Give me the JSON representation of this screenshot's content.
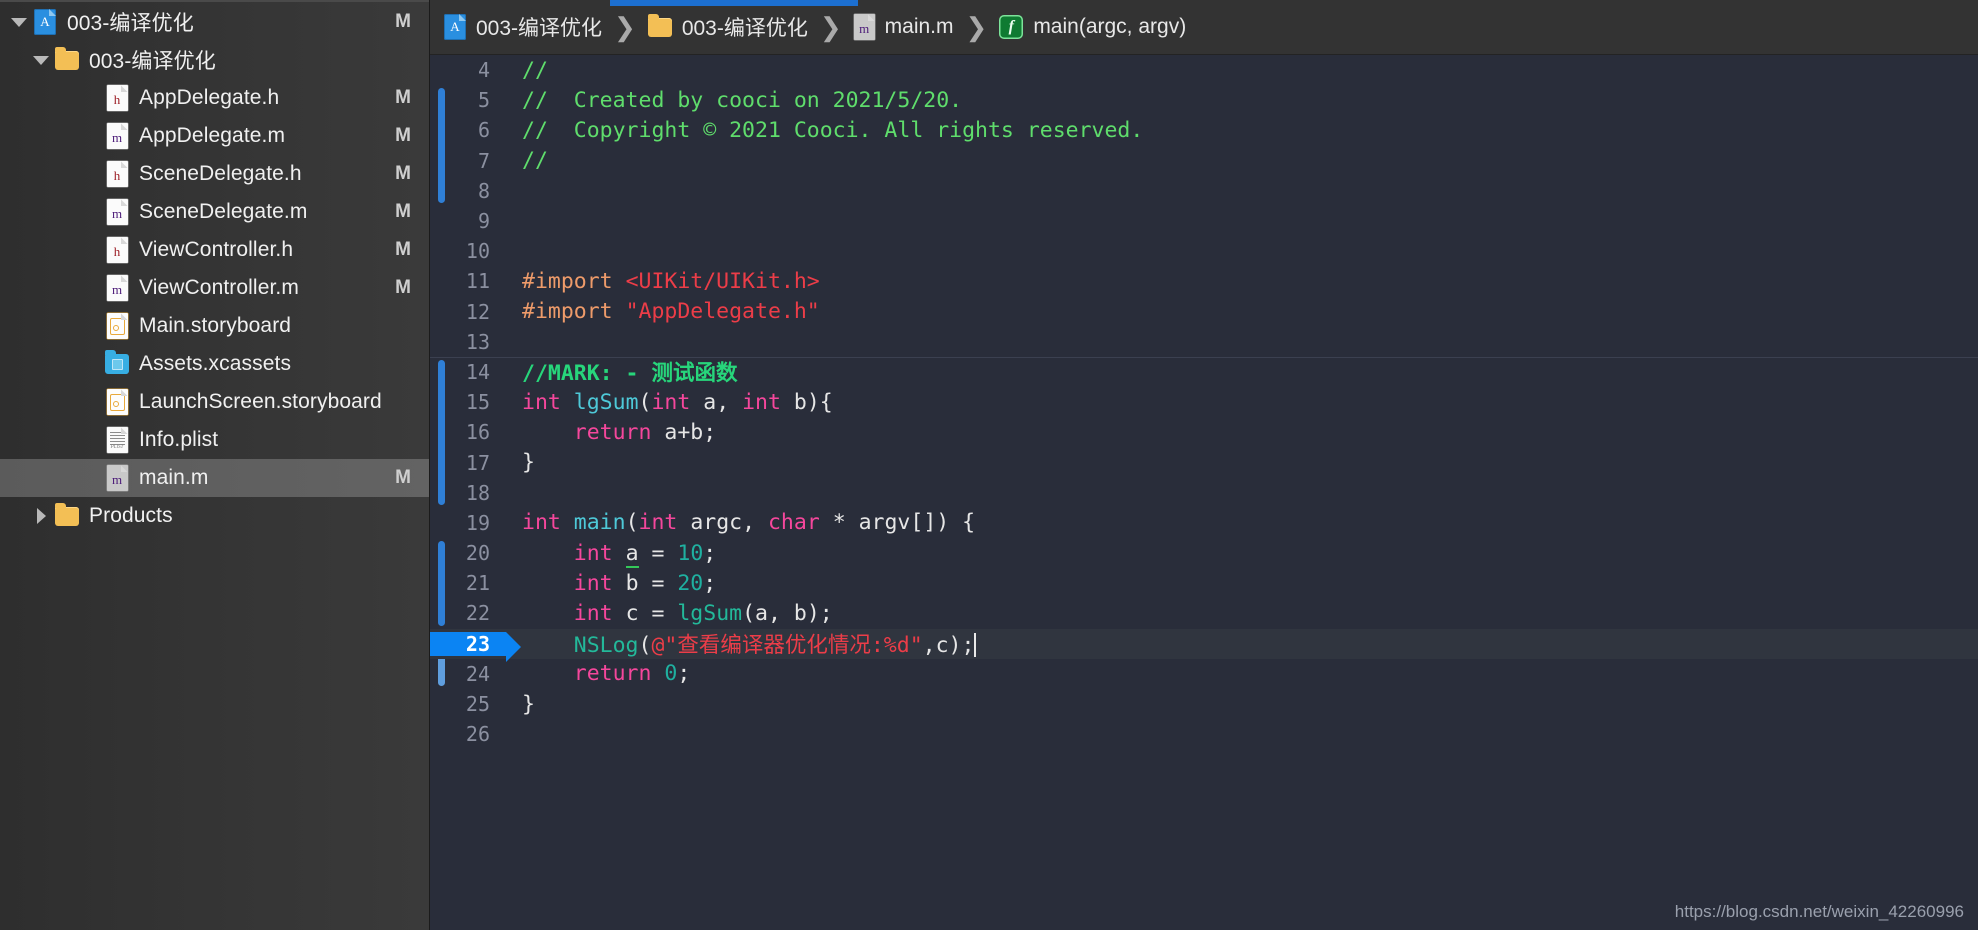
{
  "sidebar": {
    "items": [
      {
        "label": "003-编译优化",
        "icon": "xcode-project-icon",
        "badge": "M",
        "disc": "down",
        "indent": 0,
        "selected": false
      },
      {
        "label": "003-编译优化",
        "icon": "folder-icon",
        "badge": "",
        "disc": "down",
        "indent": 1,
        "selected": false
      },
      {
        "label": "AppDelegate.h",
        "icon": "header-file-icon",
        "badge": "M",
        "disc": "",
        "indent": 2,
        "selected": false
      },
      {
        "label": "AppDelegate.m",
        "icon": "objc-file-icon",
        "badge": "M",
        "disc": "",
        "indent": 2,
        "selected": false
      },
      {
        "label": "SceneDelegate.h",
        "icon": "header-file-icon",
        "badge": "M",
        "disc": "",
        "indent": 2,
        "selected": false
      },
      {
        "label": "SceneDelegate.m",
        "icon": "objc-file-icon",
        "badge": "M",
        "disc": "",
        "indent": 2,
        "selected": false
      },
      {
        "label": "ViewController.h",
        "icon": "header-file-icon",
        "badge": "M",
        "disc": "",
        "indent": 2,
        "selected": false
      },
      {
        "label": "ViewController.m",
        "icon": "objc-file-icon",
        "badge": "M",
        "disc": "",
        "indent": 2,
        "selected": false
      },
      {
        "label": "Main.storyboard",
        "icon": "storyboard-icon",
        "badge": "",
        "disc": "",
        "indent": 2,
        "selected": false
      },
      {
        "label": "Assets.xcassets",
        "icon": "xcassets-icon",
        "badge": "",
        "disc": "",
        "indent": 2,
        "selected": false
      },
      {
        "label": "LaunchScreen.storyboard",
        "icon": "storyboard-icon",
        "badge": "",
        "disc": "",
        "indent": 2,
        "selected": false
      },
      {
        "label": "Info.plist",
        "icon": "plist-file-icon",
        "badge": "",
        "disc": "",
        "indent": 2,
        "selected": false
      },
      {
        "label": "main.m",
        "icon": "objc-file-icon-grey",
        "badge": "M",
        "disc": "",
        "indent": 2,
        "selected": true
      },
      {
        "label": "Products",
        "icon": "folder-icon",
        "badge": "",
        "disc": "right",
        "indent": 1,
        "selected": false
      }
    ]
  },
  "jumpbar": {
    "crumbs": [
      {
        "label": "003-编译优化",
        "icon": "xcode-project-icon"
      },
      {
        "label": "003-编译优化",
        "icon": "folder-icon"
      },
      {
        "label": "main.m",
        "icon": "objc-file-icon-grey"
      },
      {
        "label": "main(argc, argv)",
        "icon": "function-icon"
      }
    ],
    "separator": "❯"
  },
  "editor": {
    "cursor_line": 23,
    "lines": [
      {
        "n": "4",
        "tokens": [
          {
            "t": "//",
            "c": "t-cmt"
          }
        ]
      },
      {
        "n": "5",
        "tokens": [
          {
            "t": "//  Created by cooci on 2021/5/20.",
            "c": "t-cmt"
          }
        ]
      },
      {
        "n": "6",
        "tokens": [
          {
            "t": "//  Copyright © 2021 Cooci. All rights reserved.",
            "c": "t-cmt"
          }
        ]
      },
      {
        "n": "7",
        "tokens": [
          {
            "t": "//",
            "c": "t-cmt"
          }
        ]
      },
      {
        "n": "8",
        "tokens": []
      },
      {
        "n": "9",
        "tokens": []
      },
      {
        "n": "10",
        "tokens": []
      },
      {
        "n": "11",
        "tokens": [
          {
            "t": "#import ",
            "c": "t-pre"
          },
          {
            "t": "<UIKit/UIKit.h>",
            "c": "t-str"
          }
        ]
      },
      {
        "n": "12",
        "tokens": [
          {
            "t": "#import ",
            "c": "t-pre"
          },
          {
            "t": "\"AppDelegate.h\"",
            "c": "t-str"
          }
        ]
      },
      {
        "n": "13",
        "tokens": []
      },
      {
        "n": "14",
        "tokens": [
          {
            "t": "//MARK: - 测试函数",
            "c": "t-mark"
          }
        ]
      },
      {
        "n": "15",
        "tokens": [
          {
            "t": "int",
            "c": "t-kw"
          },
          {
            "t": " ",
            "c": "t-pln"
          },
          {
            "t": "lgSum",
            "c": "t-fn"
          },
          {
            "t": "(",
            "c": "t-pln"
          },
          {
            "t": "int",
            "c": "t-kw"
          },
          {
            "t": " a, ",
            "c": "t-pln"
          },
          {
            "t": "int",
            "c": "t-kw"
          },
          {
            "t": " b){",
            "c": "t-pln"
          }
        ]
      },
      {
        "n": "16",
        "tokens": [
          {
            "t": "    ",
            "c": "t-pln"
          },
          {
            "t": "return",
            "c": "t-kw"
          },
          {
            "t": " a+b;",
            "c": "t-pln"
          }
        ]
      },
      {
        "n": "17",
        "tokens": [
          {
            "t": "}",
            "c": "t-pln"
          }
        ]
      },
      {
        "n": "18",
        "tokens": []
      },
      {
        "n": "19",
        "tokens": [
          {
            "t": "int",
            "c": "t-kw"
          },
          {
            "t": " ",
            "c": "t-pln"
          },
          {
            "t": "main",
            "c": "t-fn"
          },
          {
            "t": "(",
            "c": "t-pln"
          },
          {
            "t": "int",
            "c": "t-kw"
          },
          {
            "t": " argc, ",
            "c": "t-pln"
          },
          {
            "t": "char",
            "c": "t-kw"
          },
          {
            "t": " * argv[]) {",
            "c": "t-pln"
          }
        ]
      },
      {
        "n": "20",
        "tokens": [
          {
            "t": "    ",
            "c": "t-pln"
          },
          {
            "t": "int",
            "c": "t-kw"
          },
          {
            "t": " ",
            "c": "t-pln"
          },
          {
            "t": "a",
            "c": "t-var-warn"
          },
          {
            "t": " = ",
            "c": "t-pln"
          },
          {
            "t": "10",
            "c": "t-num"
          },
          {
            "t": ";",
            "c": "t-pln"
          }
        ]
      },
      {
        "n": "21",
        "tokens": [
          {
            "t": "    ",
            "c": "t-pln"
          },
          {
            "t": "int",
            "c": "t-kw"
          },
          {
            "t": " b = ",
            "c": "t-pln"
          },
          {
            "t": "20",
            "c": "t-num"
          },
          {
            "t": ";",
            "c": "t-pln"
          }
        ]
      },
      {
        "n": "22",
        "tokens": [
          {
            "t": "    ",
            "c": "t-pln"
          },
          {
            "t": "int",
            "c": "t-kw"
          },
          {
            "t": " c = ",
            "c": "t-pln"
          },
          {
            "t": "lgSum",
            "c": "t-call"
          },
          {
            "t": "(a, b);",
            "c": "t-pln"
          }
        ]
      },
      {
        "n": "23",
        "tokens": [
          {
            "t": "    ",
            "c": "t-pln"
          },
          {
            "t": "NSLog",
            "c": "t-call"
          },
          {
            "t": "(",
            "c": "t-pln"
          },
          {
            "t": "@\"查看编译器优化情况:%d\"",
            "c": "t-str"
          },
          {
            "t": ",c);",
            "c": "t-pln"
          }
        ]
      },
      {
        "n": "24",
        "tokens": [
          {
            "t": "    ",
            "c": "t-pln"
          },
          {
            "t": "return",
            "c": "t-kw"
          },
          {
            "t": " ",
            "c": "t-pln"
          },
          {
            "t": "0",
            "c": "t-num"
          },
          {
            "t": ";",
            "c": "t-pln"
          }
        ]
      },
      {
        "n": "25",
        "tokens": [
          {
            "t": "}",
            "c": "t-pln"
          }
        ]
      },
      {
        "n": "26",
        "tokens": []
      }
    ]
  },
  "watermark": {
    "text": "https://blog.csdn.net/weixin_42260996"
  },
  "colors": {
    "accent_blue": "#0b84f3",
    "change_bar": "#2f7fd6",
    "comment_green": "#5fdd6c",
    "mark_green": "#27d67b",
    "keyword_pink": "#f5479c",
    "string_red": "#ec3d48",
    "preproc_orange": "#ee9b6a",
    "function_cyan": "#4ec9d8",
    "call_teal": "#23b99a",
    "number_teal": "#1fb0a0",
    "editor_bg": "#292d3a",
    "sidebar_bg": "#353535"
  }
}
